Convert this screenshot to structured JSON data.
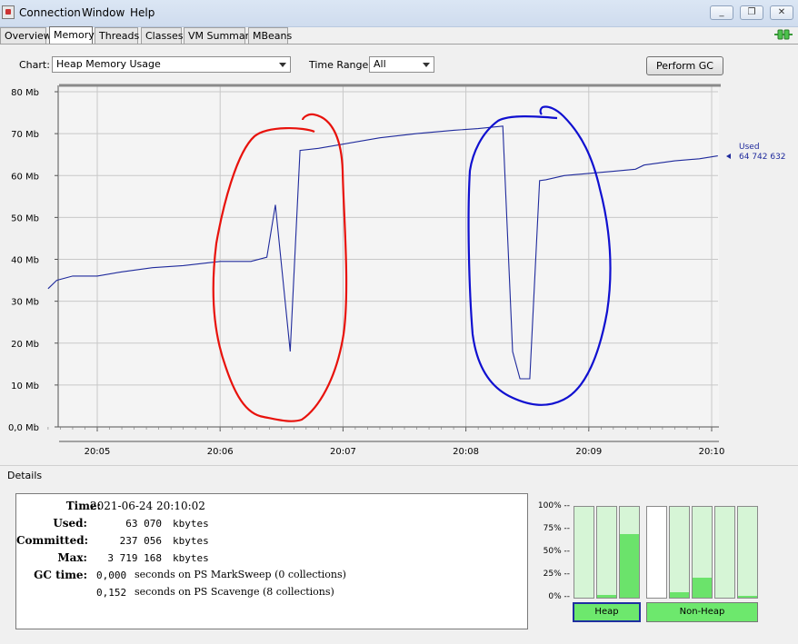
{
  "menubar": {
    "items": [
      "Connection",
      "Window",
      "Help"
    ]
  },
  "window_controls": {
    "minimize": "_",
    "restore": "❐",
    "close": "✕"
  },
  "tabs": [
    "Overview",
    "Memory",
    "Threads",
    "Classes",
    "VM Summary",
    "MBeans"
  ],
  "active_tab": "Memory",
  "controls": {
    "chart_label": "Chart:",
    "chart_value": "Heap Memory Usage",
    "time_range_label": "Time Range:",
    "time_range_value": "All",
    "perform_gc": "Perform GC"
  },
  "chart_data": {
    "type": "line",
    "y_ticks": [
      "80 Mb",
      "70 Mb",
      "60 Mb",
      "50 Mb",
      "40 Mb",
      "30 Mb",
      "20 Mb",
      "10 Mb",
      "0,0 Mb"
    ],
    "x_ticks": [
      "20:05",
      "20:06",
      "20:07",
      "20:08",
      "20:09",
      "20:10"
    ],
    "ylim": [
      0,
      80
    ],
    "xlim_minutes": [
      4.6,
      10.05
    ],
    "grid": true,
    "series": [
      {
        "name": "Used",
        "color": "#1f2a9c",
        "x": [
          4.6,
          4.67,
          4.8,
          5.0,
          5.2,
          5.45,
          5.7,
          6.0,
          6.25,
          6.38,
          6.45,
          6.57,
          6.65,
          6.8,
          7.0,
          7.3,
          7.6,
          7.9,
          8.1,
          8.3,
          8.38,
          8.44,
          8.52,
          8.6,
          8.65,
          8.8,
          9.0,
          9.2,
          9.38,
          9.45,
          9.7,
          9.9,
          10.05
        ],
        "values": [
          33.0,
          35.0,
          36.0,
          36.0,
          37.0,
          38.0,
          38.5,
          39.5,
          39.5,
          40.5,
          53.0,
          18.0,
          66.0,
          66.5,
          67.5,
          69.0,
          70.0,
          70.8,
          71.2,
          71.8,
          18.0,
          11.5,
          11.5,
          58.8,
          59.0,
          60.0,
          60.5,
          61.0,
          61.5,
          62.5,
          63.5,
          64.0,
          64.7
        ]
      }
    ],
    "current_label": "Used",
    "current_value": "64 742 632",
    "annotation_colors": [
      "#e8120c",
      "#1010d0"
    ]
  },
  "details": {
    "title": "Details",
    "time_label": "Time:",
    "time_value": "2021-06-24 20:10:02",
    "used_label": "Used:",
    "used_value": "63 070",
    "used_unit": "kbytes",
    "committed_label": "Committed:",
    "committed_value": "237 056",
    "committed_unit": "kbytes",
    "max_label": "Max:",
    "max_value": "3 719 168",
    "max_unit": "kbytes",
    "gc_label": "GC time:",
    "gc_1_value": "0,000",
    "gc_1_text": "seconds on PS MarkSweep (0 collections)",
    "gc_2_value": "0,152",
    "gc_2_text": "seconds on PS Scavenge (8 collections)"
  },
  "pools": {
    "percent_labels": [
      "100% --",
      "75% --",
      "50% --",
      "25% --",
      "0% --"
    ],
    "heap_fills": [
      0,
      0.03,
      0.7
    ],
    "nonheap_fills": [
      null,
      0.06,
      0.22,
      0,
      0.02
    ],
    "heap_button": "Heap",
    "nonheap_button": "Non-Heap"
  }
}
